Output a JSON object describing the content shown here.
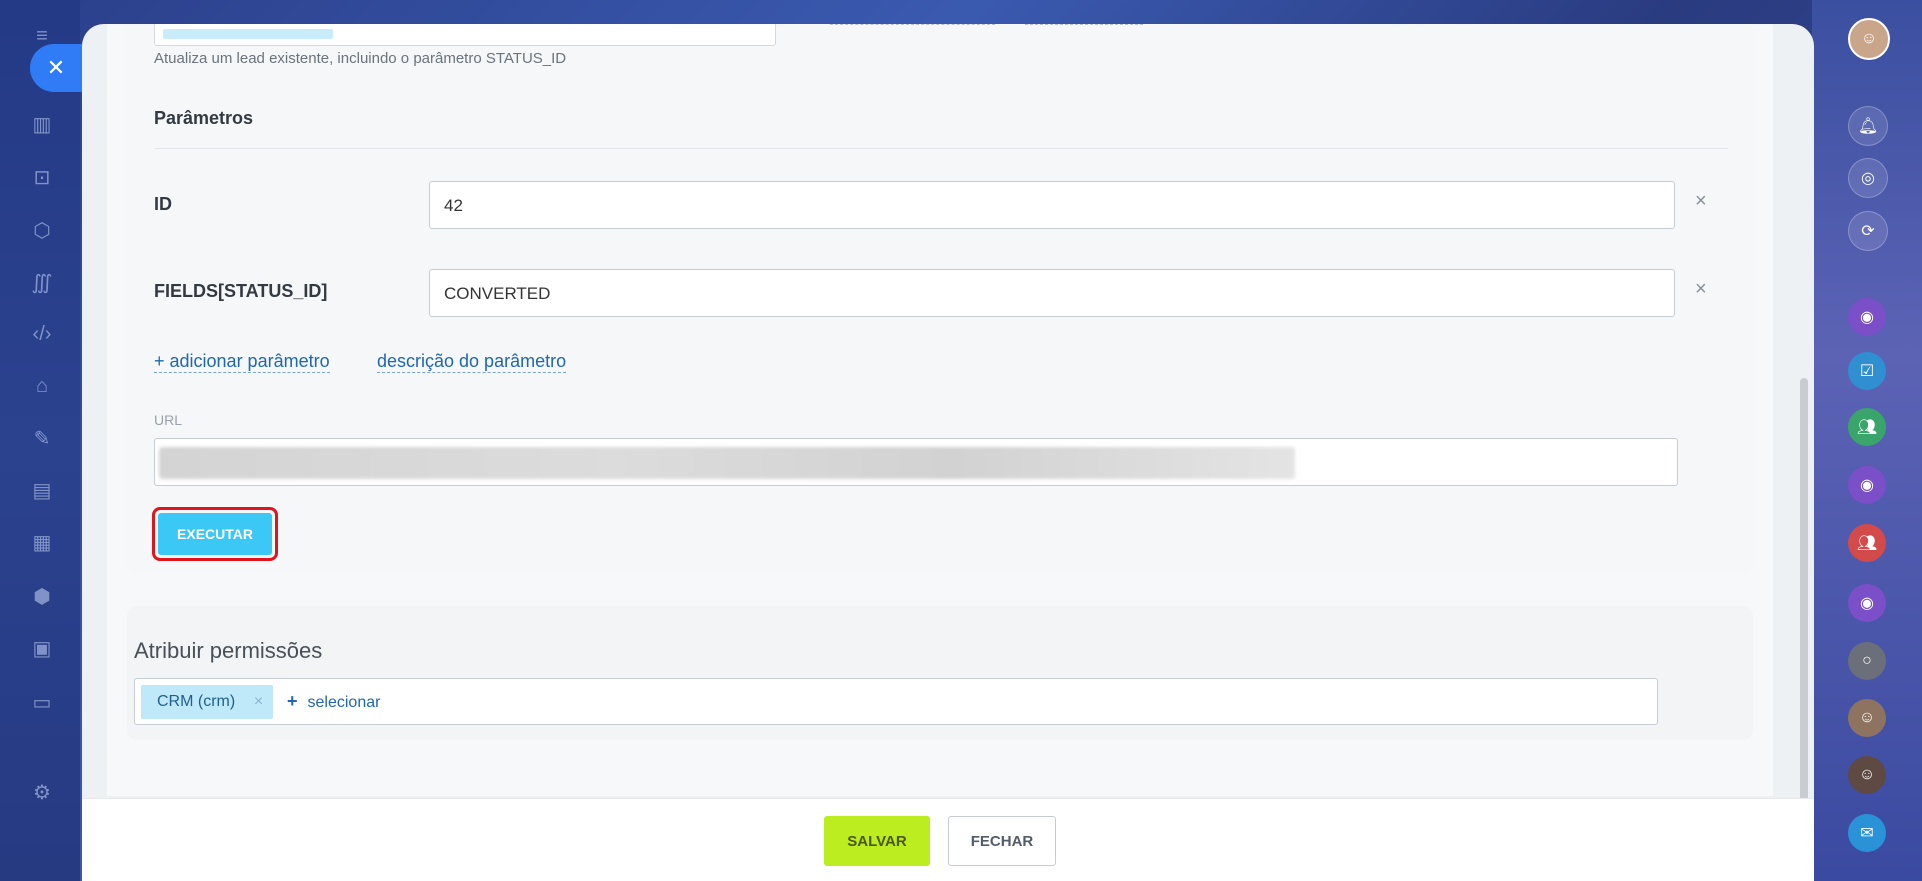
{
  "top_input": {
    "value": ""
  },
  "method_description": "Atualiza um lead existente, incluindo o parâmetro STATUS_ID",
  "parameters_section": {
    "title": "Parâmetros",
    "params": [
      {
        "label": "ID",
        "value": "42",
        "remove_icon": "×"
      },
      {
        "label": "FIELDS[STATUS_ID]",
        "value": "CONVERTED",
        "remove_icon": "×"
      }
    ],
    "add_param_label": "+ adicionar parâmetro",
    "param_description_label": "descrição do parâmetro",
    "url_label": "URL",
    "execute_label": "EXECUTAR"
  },
  "permissions": {
    "title": "Atribuir permissões",
    "chips": [
      {
        "label": "CRM (crm)",
        "remove_icon": "×"
      }
    ],
    "select_plus": "+",
    "select_label": "selecionar"
  },
  "footer": {
    "save_label": "SALVAR",
    "close_label": "FECHAR"
  },
  "left_rail": {
    "close_icon": "✕",
    "icons": [
      "menu-icon",
      "chart-icon",
      "robot-icon",
      "cube-icon",
      "brush-icon",
      "code-icon",
      "store-icon",
      "pen-icon",
      "form-icon",
      "calendar-icon",
      "shield-icon",
      "id-card-icon",
      "monitor-icon",
      "settings-icon"
    ]
  },
  "right_rail": {
    "items": [
      "avatar",
      "bell-icon",
      "target-icon",
      "sync-icon",
      "channel-icon",
      "task-icon",
      "group-icon",
      "channel-icon",
      "group-icon",
      "channel-icon",
      "circle-icon",
      "avatar",
      "avatar",
      "chat-icon"
    ]
  },
  "colors": {
    "accent_blue": "#3bc8f5",
    "save_green": "#bbed21",
    "link_blue": "#2067b0",
    "highlight_red": "#e0141c"
  }
}
